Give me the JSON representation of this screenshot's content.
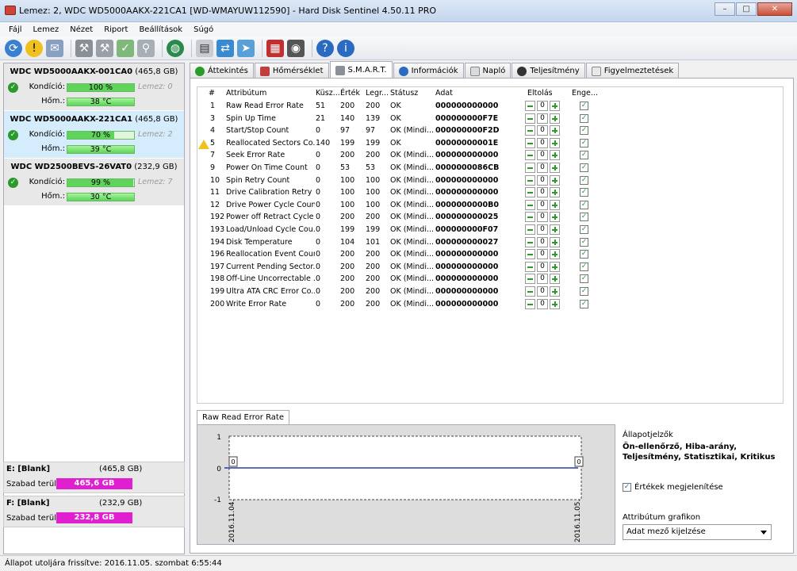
{
  "window": {
    "title": "Lemez: 2, WDC WD5000AAKX-221CA1 [WD-WMAYUW112590]  -  Hard Disk Sentinel 4.50.11 PRO"
  },
  "menu": [
    "Fájl",
    "Lemez",
    "Nézet",
    "Riport",
    "Beállítások",
    "Súgó"
  ],
  "disks": [
    {
      "name": "WDC WD5000AAKX-001CA0",
      "size": "(465,8 GB)",
      "condition_label": "Kondíció:",
      "condition": "100 %",
      "temp_label": "Hőm.:",
      "temp": "38 °C",
      "disk_no": "Lemez: 0",
      "health_pct": 100
    },
    {
      "name": "WDC WD5000AAKX-221CA1",
      "size": "(465,8 GB)",
      "condition_label": "Kondíció:",
      "condition": "70 %",
      "temp_label": "Hőm.:",
      "temp": "39 °C",
      "disk_no": "Lemez: 2",
      "health_pct": 70
    },
    {
      "name": "WDC WD2500BEVS-26VAT0",
      "size": "(232,9 GB)",
      "condition_label": "Kondíció:",
      "condition": "99 %",
      "temp_label": "Hőm.:",
      "temp": "30 °C",
      "disk_no": "Lemez: 7",
      "health_pct": 99
    }
  ],
  "partitions": [
    {
      "name": "E: [Blank]",
      "size": "(465,8 GB)",
      "free_label": "Szabad terület",
      "free": "465,6 GB"
    },
    {
      "name": "F: [Blank]",
      "size": "(232,9 GB)",
      "free_label": "Szabad terület",
      "free": "232,8 GB"
    }
  ],
  "tabs": [
    "Áttekintés",
    "Hőmérséklet",
    "S.M.A.R.T.",
    "Információk",
    "Napló",
    "Teljesítmény",
    "Figyelmeztetések"
  ],
  "smart_headers": {
    "id": "#",
    "attr": "Attribútum",
    "threshold": "Küsz...",
    "value": "Érték",
    "worst": "Legr...",
    "status": "Státusz",
    "data": "Adat",
    "offset": "Eltolás",
    "enabled": "Enge..."
  },
  "smart_rows": [
    {
      "icon": "ok",
      "id": "1",
      "attr": "Raw Read Error Rate",
      "thr": "51",
      "val": "200",
      "worst": "200",
      "status": "OK",
      "data": "000000000000",
      "offset": "0"
    },
    {
      "icon": "ok",
      "id": "3",
      "attr": "Spin Up Time",
      "thr": "21",
      "val": "140",
      "worst": "139",
      "status": "OK",
      "data": "000000000F7E",
      "offset": "0"
    },
    {
      "icon": "",
      "id": "4",
      "attr": "Start/Stop Count",
      "thr": "0",
      "val": "97",
      "worst": "97",
      "status": "OK (Mindi...",
      "data": "000000000F2D",
      "offset": "0"
    },
    {
      "icon": "warn",
      "id": "5",
      "attr": "Reallocated Sectors Co...",
      "thr": "140",
      "val": "199",
      "worst": "199",
      "status": "OK",
      "data": "00000000001E",
      "offset": "0"
    },
    {
      "icon": "",
      "id": "7",
      "attr": "Seek Error Rate",
      "thr": "0",
      "val": "200",
      "worst": "200",
      "status": "OK (Mindi...",
      "data": "000000000000",
      "offset": "0"
    },
    {
      "icon": "",
      "id": "9",
      "attr": "Power On Time Count",
      "thr": "0",
      "val": "53",
      "worst": "53",
      "status": "OK (Mindi...",
      "data": "0000000086CB",
      "offset": "0"
    },
    {
      "icon": "ok",
      "id": "10",
      "attr": "Spin Retry Count",
      "thr": "0",
      "val": "100",
      "worst": "100",
      "status": "OK (Mindi...",
      "data": "000000000000",
      "offset": "0"
    },
    {
      "icon": "",
      "id": "11",
      "attr": "Drive Calibration Retry ...",
      "thr": "0",
      "val": "100",
      "worst": "100",
      "status": "OK (Mindi...",
      "data": "000000000000",
      "offset": "0"
    },
    {
      "icon": "",
      "id": "12",
      "attr": "Drive Power Cycle Count",
      "thr": "0",
      "val": "100",
      "worst": "100",
      "status": "OK (Mindi...",
      "data": "0000000000B0",
      "offset": "0"
    },
    {
      "icon": "",
      "id": "192",
      "attr": "Power off Retract Cycle ...",
      "thr": "0",
      "val": "200",
      "worst": "200",
      "status": "OK (Mindi...",
      "data": "000000000025",
      "offset": "0"
    },
    {
      "icon": "",
      "id": "193",
      "attr": "Load/Unload Cycle Cou...",
      "thr": "0",
      "val": "199",
      "worst": "199",
      "status": "OK (Mindi...",
      "data": "000000000F07",
      "offset": "0"
    },
    {
      "icon": "",
      "id": "194",
      "attr": "Disk Temperature",
      "thr": "0",
      "val": "104",
      "worst": "101",
      "status": "OK (Mindi...",
      "data": "000000000027",
      "offset": "0"
    },
    {
      "icon": "ok",
      "id": "196",
      "attr": "Reallocation Event Count",
      "thr": "0",
      "val": "200",
      "worst": "200",
      "status": "OK (Mindi...",
      "data": "000000000000",
      "offset": "0"
    },
    {
      "icon": "ok",
      "id": "197",
      "attr": "Current Pending Sector...",
      "thr": "0",
      "val": "200",
      "worst": "200",
      "status": "OK (Mindi...",
      "data": "000000000000",
      "offset": "0"
    },
    {
      "icon": "ok",
      "id": "198",
      "attr": "Off-Line Uncorrectable ...",
      "thr": "0",
      "val": "200",
      "worst": "200",
      "status": "OK (Mindi...",
      "data": "000000000000",
      "offset": "0"
    },
    {
      "icon": "",
      "id": "199",
      "attr": "Ultra ATA CRC Error Co...",
      "thr": "0",
      "val": "200",
      "worst": "200",
      "status": "OK (Mindi...",
      "data": "000000000000",
      "offset": "0"
    },
    {
      "icon": "",
      "id": "200",
      "attr": "Write Error Rate",
      "thr": "0",
      "val": "200",
      "worst": "200",
      "status": "OK (Mindi...",
      "data": "000000000000",
      "offset": "0"
    }
  ],
  "graph": {
    "tab_label": "Raw Read Error Rate",
    "y_ticks": [
      "1",
      "0",
      "-1"
    ],
    "x_labels": [
      "2016.11.04.",
      "2016.11.05."
    ],
    "value_labels": [
      "0",
      "0"
    ]
  },
  "side": {
    "indicators_title": "Állapotjelzők",
    "indicators": "Ön-ellenőrző, Hiba-arány, Teljesítmény, Statisztikai, Kritikus",
    "show_values_label": "Értékek megjelenítése",
    "attr_graph_label": "Attribútum grafikon",
    "select_value": "Adat mező kijelzése"
  },
  "status_bar": "Állapot utoljára frissítve: 2016.11.05. szombat 6:55:44"
}
